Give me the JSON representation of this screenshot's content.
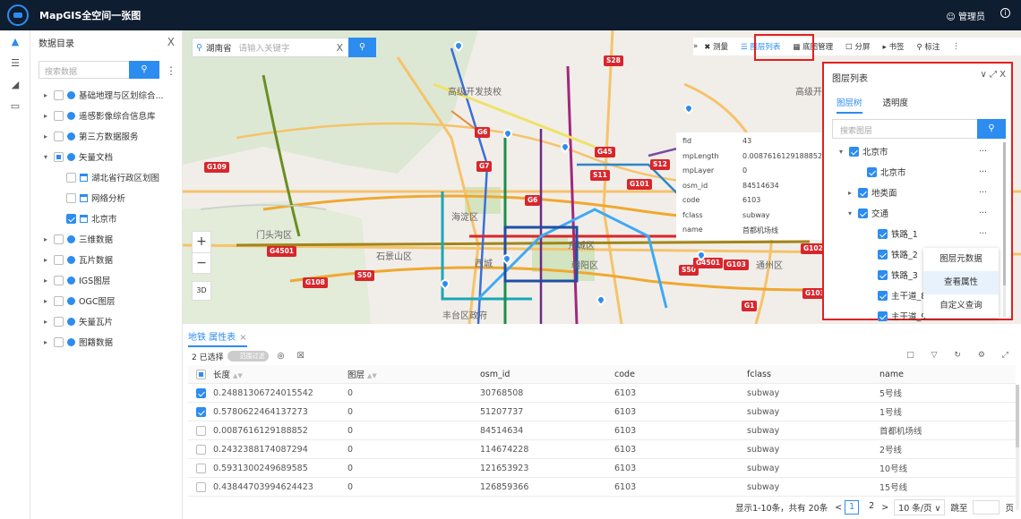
{
  "header": {
    "title": "MapGIS全空间一张图",
    "user": "管理员",
    "info_icon": "i"
  },
  "catalog": {
    "title": "数据目录",
    "close": "X",
    "search_placeholder": "搜索数据",
    "items": [
      {
        "label": "基础地理与区划综合...",
        "checked": false,
        "expanded": false
      },
      {
        "label": "遥感影像综合信息库",
        "checked": false,
        "expanded": false
      },
      {
        "label": "第三方数据服务",
        "checked": false,
        "expanded": false
      },
      {
        "label": "矢量文档",
        "checked": "partial",
        "expanded": true
      },
      {
        "label": "湖北省行政区划图",
        "checked": false,
        "child": true
      },
      {
        "label": "网络分析",
        "checked": false,
        "child": true
      },
      {
        "label": "北京市",
        "checked": true,
        "child": true
      },
      {
        "label": "三维数据",
        "checked": false,
        "expanded": false
      },
      {
        "label": "瓦片数据",
        "checked": false,
        "expanded": false
      },
      {
        "label": "IGS图层",
        "checked": false,
        "expanded": false
      },
      {
        "label": "OGC图层",
        "checked": false,
        "expanded": false
      },
      {
        "label": "矢量瓦片",
        "checked": false,
        "expanded": false
      },
      {
        "label": "图籍数据",
        "checked": false,
        "expanded": false
      }
    ]
  },
  "map_search": {
    "province": "湖南省",
    "placeholder": "请输入关键字",
    "clear": "X"
  },
  "toolbar": {
    "collapse": "»",
    "items": [
      {
        "label": "测量",
        "active": false
      },
      {
        "label": "图层列表",
        "active": true
      },
      {
        "label": "底图管理",
        "active": false
      },
      {
        "label": "分屏",
        "active": false
      },
      {
        "label": "书签",
        "active": false
      },
      {
        "label": "标注",
        "active": false
      }
    ],
    "more": "⋮"
  },
  "map": {
    "zoom_in": "+",
    "zoom_out": "−",
    "mode": "3D",
    "labels": [
      {
        "text": "高级开发技校"
      },
      {
        "text": "高级开"
      },
      {
        "text": "海淀区"
      },
      {
        "text": "门头沟区"
      },
      {
        "text": "石景山区"
      },
      {
        "text": "西城"
      },
      {
        "text": "东城区"
      },
      {
        "text": "朝阳区"
      },
      {
        "text": "通州区"
      },
      {
        "text": "丰台区政府"
      }
    ],
    "shields": [
      "S28",
      "G6",
      "G45",
      "G7",
      "S11",
      "S12",
      "G109",
      "G101",
      "G6",
      "G4501",
      "S50",
      "G108",
      "S50",
      "G103",
      "G102",
      "G1",
      "G103",
      "G4501"
    ]
  },
  "feature_popup": {
    "rows": [
      {
        "key": "fid",
        "value": "43"
      },
      {
        "key": "mpLength",
        "value": "0.0087616129188852"
      },
      {
        "key": "mpLayer",
        "value": "0"
      },
      {
        "key": "osm_id",
        "value": "84514634"
      },
      {
        "key": "code",
        "value": "6103"
      },
      {
        "key": "fclass",
        "value": "subway"
      },
      {
        "key": "name",
        "value": "首都机场线"
      }
    ]
  },
  "layer_panel": {
    "title": "图层列表",
    "controls": "∨  ⤢  X",
    "tabs": [
      "图层树",
      "透明度"
    ],
    "search_placeholder": "搜索图层",
    "rows": [
      {
        "label": "北京市",
        "checked": true,
        "arrow": "▾",
        "more": "···"
      },
      {
        "label": "北京市",
        "checked": true,
        "arrow": "",
        "more": "···"
      },
      {
        "label": "地类面",
        "checked": true,
        "arrow": "▸",
        "more": "···"
      },
      {
        "label": "交通",
        "checked": true,
        "arrow": "▾",
        "more": "···"
      },
      {
        "label": "铁路_1",
        "checked": true,
        "arrow": "",
        "more": "···"
      },
      {
        "label": "铁路_2",
        "checked": true,
        "arrow": "",
        "more": ""
      },
      {
        "label": "铁路_3",
        "checked": true,
        "arrow": "",
        "more": ""
      },
      {
        "label": "主干道_8",
        "checked": true,
        "arrow": "",
        "more": ""
      },
      {
        "label": "主干道_9",
        "checked": true,
        "arrow": "",
        "more": ""
      }
    ]
  },
  "context_menu": {
    "items": [
      "图层元数据",
      "查看属性",
      "自定义查询"
    ]
  },
  "attribute_table": {
    "tab_label": "地铁 属性表",
    "tab_close": "×",
    "selected_text": "2 已选择",
    "toggle_label": "范围过滤",
    "columns": [
      "长度",
      "图层",
      "osm_id",
      "code",
      "fclass",
      "name"
    ],
    "rows": [
      {
        "checked": true,
        "length": "0.24881306724015542",
        "layer": "0",
        "osm_id": "30768508",
        "code": "6103",
        "fclass": "subway",
        "name": "5号线"
      },
      {
        "checked": true,
        "length": "0.5780622464137273",
        "layer": "0",
        "osm_id": "51207737",
        "code": "6103",
        "fclass": "subway",
        "name": "1号线"
      },
      {
        "checked": false,
        "length": "0.0087616129188852",
        "layer": "0",
        "osm_id": "84514634",
        "code": "6103",
        "fclass": "subway",
        "name": "首都机场线"
      },
      {
        "checked": false,
        "length": "0.2432388174087294",
        "layer": "0",
        "osm_id": "114674228",
        "code": "6103",
        "fclass": "subway",
        "name": "2号线"
      },
      {
        "checked": false,
        "length": "0.5931300249689585",
        "layer": "0",
        "osm_id": "121653923",
        "code": "6103",
        "fclass": "subway",
        "name": "10号线"
      },
      {
        "checked": false,
        "length": "0.43844703994624423",
        "layer": "0",
        "osm_id": "126859366",
        "code": "6103",
        "fclass": "subway",
        "name": "15号线"
      }
    ],
    "pager": {
      "summary": "显示1-10条，共有 20条",
      "prev": "<",
      "pages": [
        "1",
        "2"
      ],
      "next": ">",
      "page_size": "10 条/页 ∨",
      "jump_label": "跳至",
      "page_unit": "页"
    }
  },
  "colors": {
    "accent": "#2d8cf0",
    "highlight": "#e02020",
    "header_bg": "#0f1d30"
  }
}
